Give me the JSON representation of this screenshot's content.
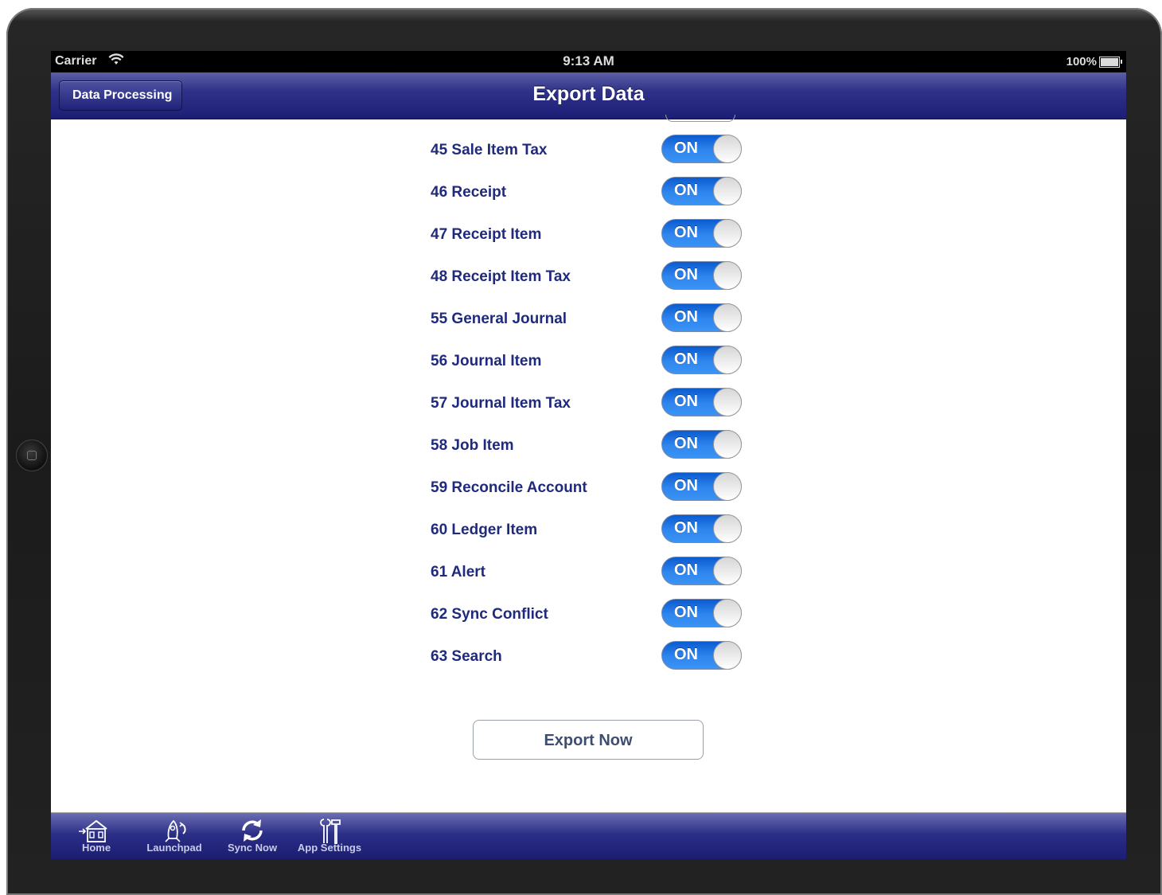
{
  "statusbar": {
    "carrier": "Carrier",
    "time": "9:13 AM",
    "battery": "100%"
  },
  "navbar": {
    "back_label": "Data Processing",
    "title": "Export Data"
  },
  "rows": [
    {
      "label": "45 Sale Item Tax",
      "state": "ON"
    },
    {
      "label": "46 Receipt",
      "state": "ON"
    },
    {
      "label": "47 Receipt Item",
      "state": "ON"
    },
    {
      "label": "48 Receipt Item Tax",
      "state": "ON"
    },
    {
      "label": "55 General Journal",
      "state": "ON"
    },
    {
      "label": "56 Journal Item",
      "state": "ON"
    },
    {
      "label": "57 Journal Item Tax",
      "state": "ON"
    },
    {
      "label": "58 Job Item",
      "state": "ON"
    },
    {
      "label": "59 Reconcile Account",
      "state": "ON"
    },
    {
      "label": "60 Ledger Item",
      "state": "ON"
    },
    {
      "label": "61 Alert",
      "state": "ON"
    },
    {
      "label": "62 Sync Conflict",
      "state": "ON"
    },
    {
      "label": "63 Search",
      "state": "ON"
    }
  ],
  "export_button": "Export Now",
  "toolbar": {
    "items": [
      {
        "label": "Home",
        "icon": "home-icon"
      },
      {
        "label": "Launchpad",
        "icon": "launchpad-icon"
      },
      {
        "label": "Sync Now",
        "icon": "sync-icon"
      },
      {
        "label": "App Settings",
        "icon": "tools-icon"
      }
    ]
  },
  "colors": {
    "nav_blue": "#1b1e74",
    "switch_on": "#2f86ee",
    "label_text": "#1f2a7d"
  }
}
